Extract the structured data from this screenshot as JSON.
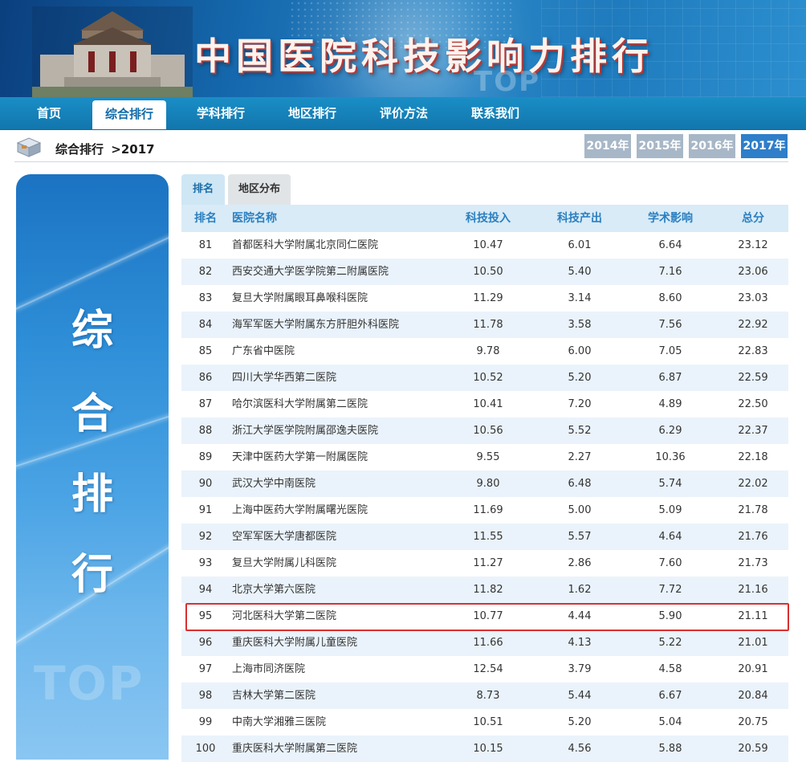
{
  "banner": {
    "title": "中国医院科技影响力排行",
    "watermark": "TOP"
  },
  "nav": {
    "items": [
      {
        "label": "首页"
      },
      {
        "label": "综合排行",
        "active": true
      },
      {
        "label": "学科排行"
      },
      {
        "label": "地区排行"
      },
      {
        "label": "评价方法"
      },
      {
        "label": "联系我们"
      }
    ]
  },
  "breadcrumb": {
    "section": "综合排行",
    "separator": ">",
    "year": "2017"
  },
  "years": [
    {
      "label": "2014年"
    },
    {
      "label": "2015年"
    },
    {
      "label": "2016年"
    },
    {
      "label": "2017年",
      "active": true
    }
  ],
  "side_panel": {
    "chars": [
      "综",
      "合",
      "排",
      "行"
    ],
    "watermark": "TOP"
  },
  "content_tabs": [
    {
      "label": "排名",
      "active": true
    },
    {
      "label": "地区分布"
    }
  ],
  "table": {
    "headers": [
      "排名",
      "医院名称",
      "科技投入",
      "科技产出",
      "学术影响",
      "总分"
    ],
    "rows": [
      [
        "81",
        "首都医科大学附属北京同仁医院",
        "10.47",
        "6.01",
        "6.64",
        "23.12"
      ],
      [
        "82",
        "西安交通大学医学院第二附属医院",
        "10.50",
        "5.40",
        "7.16",
        "23.06"
      ],
      [
        "83",
        "复旦大学附属眼耳鼻喉科医院",
        "11.29",
        "3.14",
        "8.60",
        "23.03"
      ],
      [
        "84",
        "海军军医大学附属东方肝胆外科医院",
        "11.78",
        "3.58",
        "7.56",
        "22.92"
      ],
      [
        "85",
        "广东省中医院",
        "9.78",
        "6.00",
        "7.05",
        "22.83"
      ],
      [
        "86",
        "四川大学华西第二医院",
        "10.52",
        "5.20",
        "6.87",
        "22.59"
      ],
      [
        "87",
        "哈尔滨医科大学附属第二医院",
        "10.41",
        "7.20",
        "4.89",
        "22.50"
      ],
      [
        "88",
        "浙江大学医学院附属邵逸夫医院",
        "10.56",
        "5.52",
        "6.29",
        "22.37"
      ],
      [
        "89",
        "天津中医药大学第一附属医院",
        "9.55",
        "2.27",
        "10.36",
        "22.18"
      ],
      [
        "90",
        "武汉大学中南医院",
        "9.80",
        "6.48",
        "5.74",
        "22.02"
      ],
      [
        "91",
        "上海中医药大学附属曙光医院",
        "11.69",
        "5.00",
        "5.09",
        "21.78"
      ],
      [
        "92",
        "空军军医大学唐都医院",
        "11.55",
        "5.57",
        "4.64",
        "21.76"
      ],
      [
        "93",
        "复旦大学附属儿科医院",
        "11.27",
        "2.86",
        "7.60",
        "21.73"
      ],
      [
        "94",
        "北京大学第六医院",
        "11.82",
        "1.62",
        "7.72",
        "21.16"
      ],
      [
        "95",
        "河北医科大学第二医院",
        "10.77",
        "4.44",
        "5.90",
        "21.11"
      ],
      [
        "96",
        "重庆医科大学附属儿童医院",
        "11.66",
        "4.13",
        "5.22",
        "21.01"
      ],
      [
        "97",
        "上海市同济医院",
        "12.54",
        "3.79",
        "4.58",
        "20.91"
      ],
      [
        "98",
        "吉林大学第二医院",
        "8.73",
        "5.44",
        "6.67",
        "20.84"
      ],
      [
        "99",
        "中南大学湘雅三医院",
        "10.51",
        "5.20",
        "5.04",
        "20.75"
      ],
      [
        "100",
        "重庆医科大学附属第二医院",
        "10.15",
        "4.56",
        "5.88",
        "20.59"
      ]
    ],
    "highlighted_rank": "95"
  },
  "colors": {
    "nav_bg": "#1a8ec6",
    "header_text": "#2b7fc0",
    "row_alt": "#eaf3fb",
    "year_active": "#2e7ec9",
    "year_inactive": "#a7b7c7",
    "highlight_border": "#d83030"
  }
}
